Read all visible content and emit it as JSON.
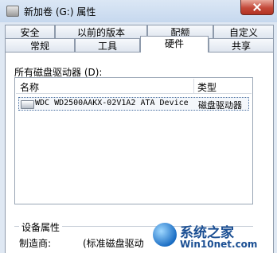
{
  "window": {
    "title": "新加卷 (G:) 属性"
  },
  "tabs": [
    {
      "label": "安全"
    },
    {
      "label": "以前的版本"
    },
    {
      "label": "配额"
    },
    {
      "label": "自定义"
    },
    {
      "label": "常规"
    },
    {
      "label": "工具"
    },
    {
      "label": "硬件",
      "active": true
    },
    {
      "label": "共享"
    }
  ],
  "hardware": {
    "list_label": "所有磁盘驱动器 (D):",
    "columns": {
      "name": "名称",
      "type": "类型"
    },
    "rows": [
      {
        "name": "WDC WD2500AAKX-02V1A2 ATA Device",
        "type": "磁盘驱动器",
        "selected": true
      }
    ],
    "device_properties": {
      "group_label": "设备属性",
      "manufacturer_label": "制造商:",
      "manufacturer_value": "(标准磁盘驱动"
    }
  },
  "watermark": {
    "title": "系统之家",
    "subtitle": "Win10net.com"
  },
  "colors": {
    "accent": "#1b4f93",
    "close_button": "#c4493a"
  }
}
